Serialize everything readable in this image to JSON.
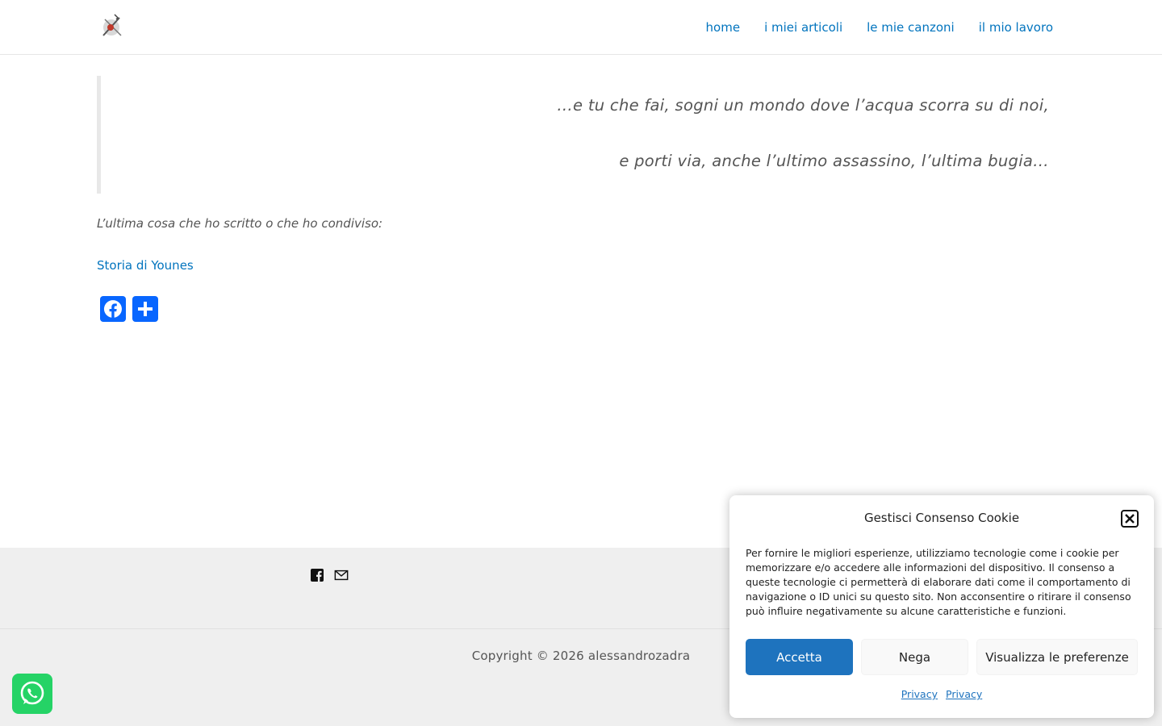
{
  "header": {
    "nav": [
      "home",
      "i miei articoli",
      "le mie canzoni",
      "il mio lavoro"
    ]
  },
  "quote": {
    "line1": "…e tu che fai, sogni un mondo dove l’acqua scorra su di noi,",
    "line2": "e porti via, anche l’ultimo assassino, l’ultima bugia…"
  },
  "main": {
    "last_label": "L’ultima cosa che ho scritto o che ho condiviso:",
    "last_link": "Storia di Younes"
  },
  "share": {
    "icons": [
      "facebook-icon",
      "share-icon"
    ],
    "color": "#0866ff"
  },
  "footer": {
    "icons": [
      "facebook-square-icon",
      "mail-icon"
    ],
    "copyright": "Copyright © 2026 alessandrozadra"
  },
  "cookie": {
    "title": "Gestisci Consenso Cookie",
    "text": "Per fornire le migliori esperienze, utilizziamo tecnologie come i cookie per memorizzare e/o accedere alle informazioni del dispositivo. Il consenso a queste tecnologie ci permetterà di elaborare dati come il comportamento di navigazione o ID unici su questo sito. Non acconsentire o ritirare il consenso può influire negativamente su alcune caratteristiche e funzioni.",
    "accept": "Accetta",
    "deny": "Nega",
    "prefs": "Visualizza le preferenze",
    "link1": "Privacy",
    "link2": "Privacy",
    "accent": "#1e73be"
  },
  "colors": {
    "link": "#0274be",
    "whatsapp": "#25d366"
  }
}
